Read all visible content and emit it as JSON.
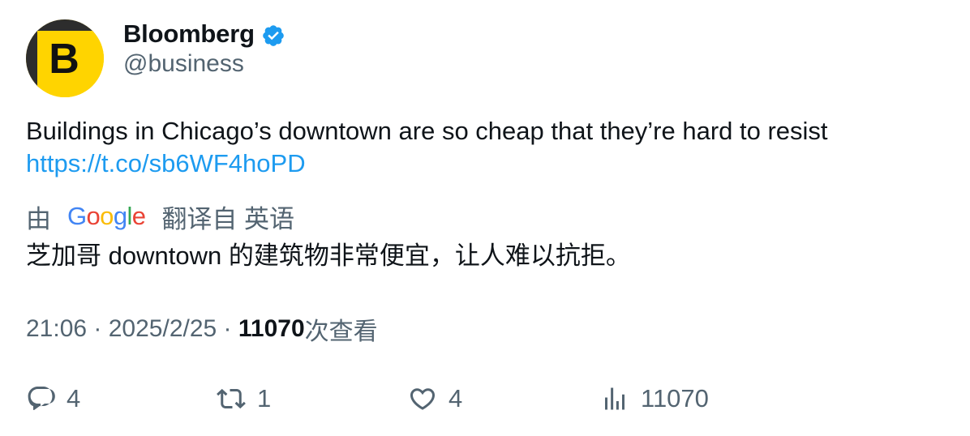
{
  "author": {
    "name": "Bloomberg",
    "handle": "@business",
    "avatar_letter": "B",
    "verified": true
  },
  "tweet": {
    "text": "Buildings in Chicago’s downtown are so cheap that they’re hard to resist",
    "link": "https://t.co/sb6WF4hoPD"
  },
  "translation": {
    "by": "由",
    "google_letters": [
      "G",
      "o",
      "o",
      "g",
      "l",
      "e"
    ],
    "google_colors": [
      "#4285F4",
      "#EA4335",
      "#FBBC05",
      "#4285F4",
      "#34A853",
      "#EA4335"
    ],
    "translated_from": "翻译自 英语",
    "text": "芝加哥 downtown 的建筑物非常便宜，让人难以抗拒。"
  },
  "meta": {
    "time": "21:06",
    "separator": " · ",
    "date": "2025/2/25",
    "views_count": "11070",
    "views_label": "次查看"
  },
  "actions": {
    "replies": "4",
    "retweets": "1",
    "likes": "4",
    "views": "11070"
  },
  "colors": {
    "accent": "#1d9bf0",
    "secondary_text": "#536471",
    "avatar_yellow": "#ffd400"
  }
}
